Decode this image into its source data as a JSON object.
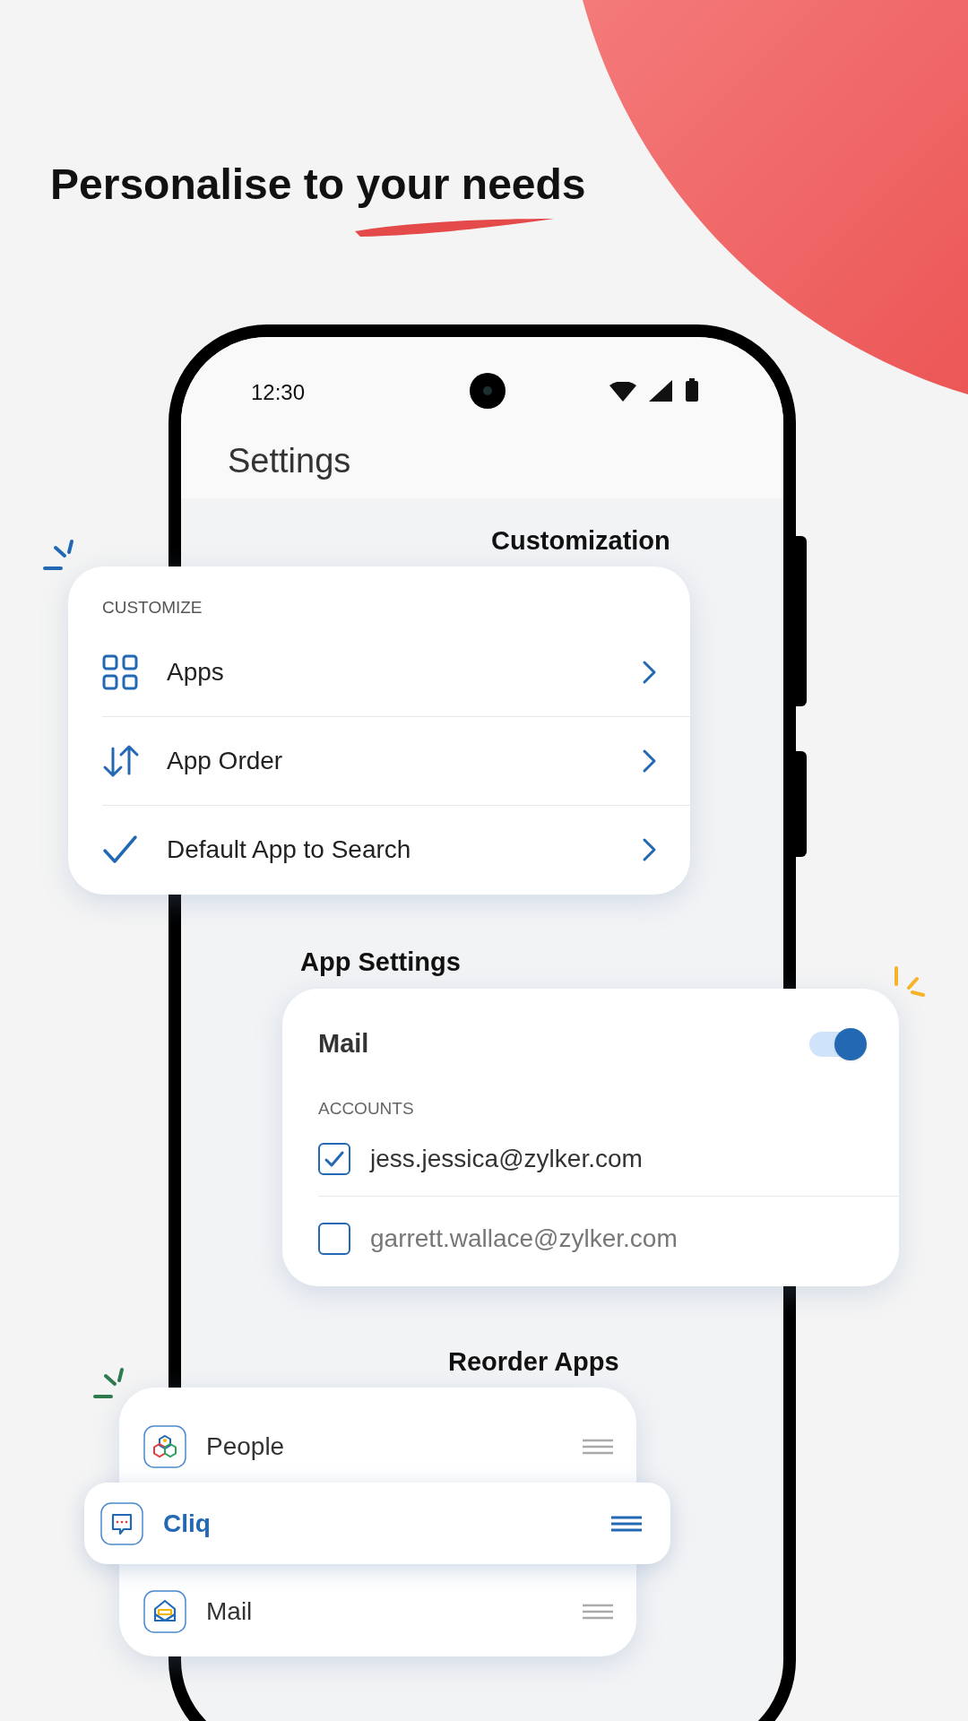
{
  "headline": "Personalise to your needs",
  "status_bar": {
    "time": "12:30"
  },
  "screen": {
    "title": "Settings"
  },
  "sections": {
    "customization": "Customization",
    "app_settings": "App Settings",
    "reorder": "Reorder Apps"
  },
  "customize_card": {
    "header": "CUSTOMIZE",
    "items": [
      {
        "kind": "grid",
        "label": "Apps"
      },
      {
        "kind": "order",
        "label": "App Order"
      },
      {
        "kind": "check",
        "label": "Default App to Search"
      }
    ]
  },
  "mail_card": {
    "title": "Mail",
    "on": true,
    "accounts_header": "ACCOUNTS",
    "accounts": [
      {
        "email": "jess.jessica@zylker.com",
        "checked": true
      },
      {
        "email": "garrett.wallace@zylker.com",
        "checked": false
      }
    ]
  },
  "reorder_list": [
    {
      "kind": "people",
      "label": "People",
      "selected": false
    },
    {
      "kind": "cliq",
      "label": "Cliq",
      "selected": true
    },
    {
      "kind": "mail",
      "label": "Mail",
      "selected": false
    }
  ]
}
